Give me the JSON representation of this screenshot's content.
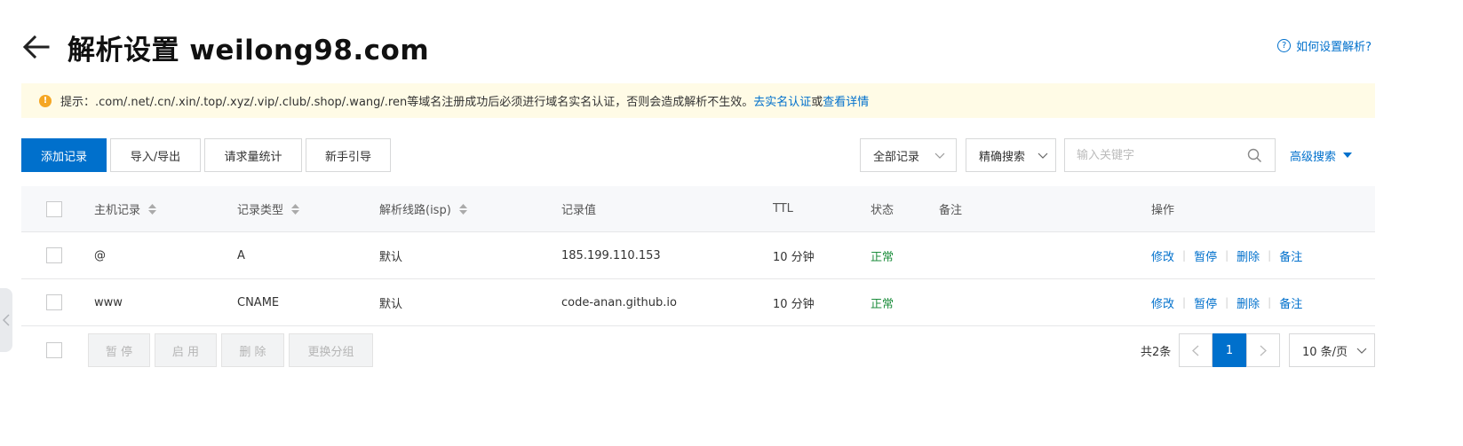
{
  "header": {
    "title": "解析设置 weilong98.com",
    "help_label": "如何设置解析?"
  },
  "notice": {
    "text": "提示：.com/.net/.cn/.xin/.top/.xyz/.vip/.club/.shop/.wang/.ren等域名注册成功后必须进行域名实名认证，否则会造成解析不生效。",
    "link_realname": "去实名认证",
    "connector": "或",
    "link_details": "查看详情"
  },
  "toolbar": {
    "add_label": "添加记录",
    "import_export_label": "导入/导出",
    "stats_label": "请求量统计",
    "guide_label": "新手引导",
    "filter_select": "全部记录",
    "search_mode_select": "精确搜索",
    "search_placeholder": "输入关键字",
    "advanced_label": "高级搜索"
  },
  "table": {
    "columns": [
      "主机记录",
      "记录类型",
      "解析线路(isp)",
      "记录值",
      "TTL",
      "状态",
      "备注",
      "操作"
    ],
    "rows": [
      {
        "host": "@",
        "type": "A",
        "line": "默认",
        "value": "185.199.110.153",
        "ttl": "10 分钟",
        "status": "正常",
        "note": ""
      },
      {
        "host": "www",
        "type": "CNAME",
        "line": "默认",
        "value": "code-anan.github.io",
        "ttl": "10 分钟",
        "status": "正常",
        "note": ""
      }
    ],
    "actions": [
      "修改",
      "暂停",
      "删除",
      "备注"
    ]
  },
  "footer": {
    "pause_label": "暂 停",
    "enable_label": "启 用",
    "delete_label": "删 除",
    "change_group_label": "更换分组",
    "total_label": "共2条",
    "current_page": "1",
    "page_size": "10 条/页"
  },
  "colors": {
    "primary": "#0070cc",
    "status_ok": "#1e8e3e",
    "notice_bg": "#fffbe6",
    "notice_icon": "#f5a623"
  },
  "icons": [
    "back-arrow-icon",
    "help-circle-icon",
    "warning-icon",
    "chevron-down-icon",
    "search-icon",
    "caret-down-icon",
    "sort-icon",
    "chevron-left-icon",
    "chevron-right-icon"
  ]
}
